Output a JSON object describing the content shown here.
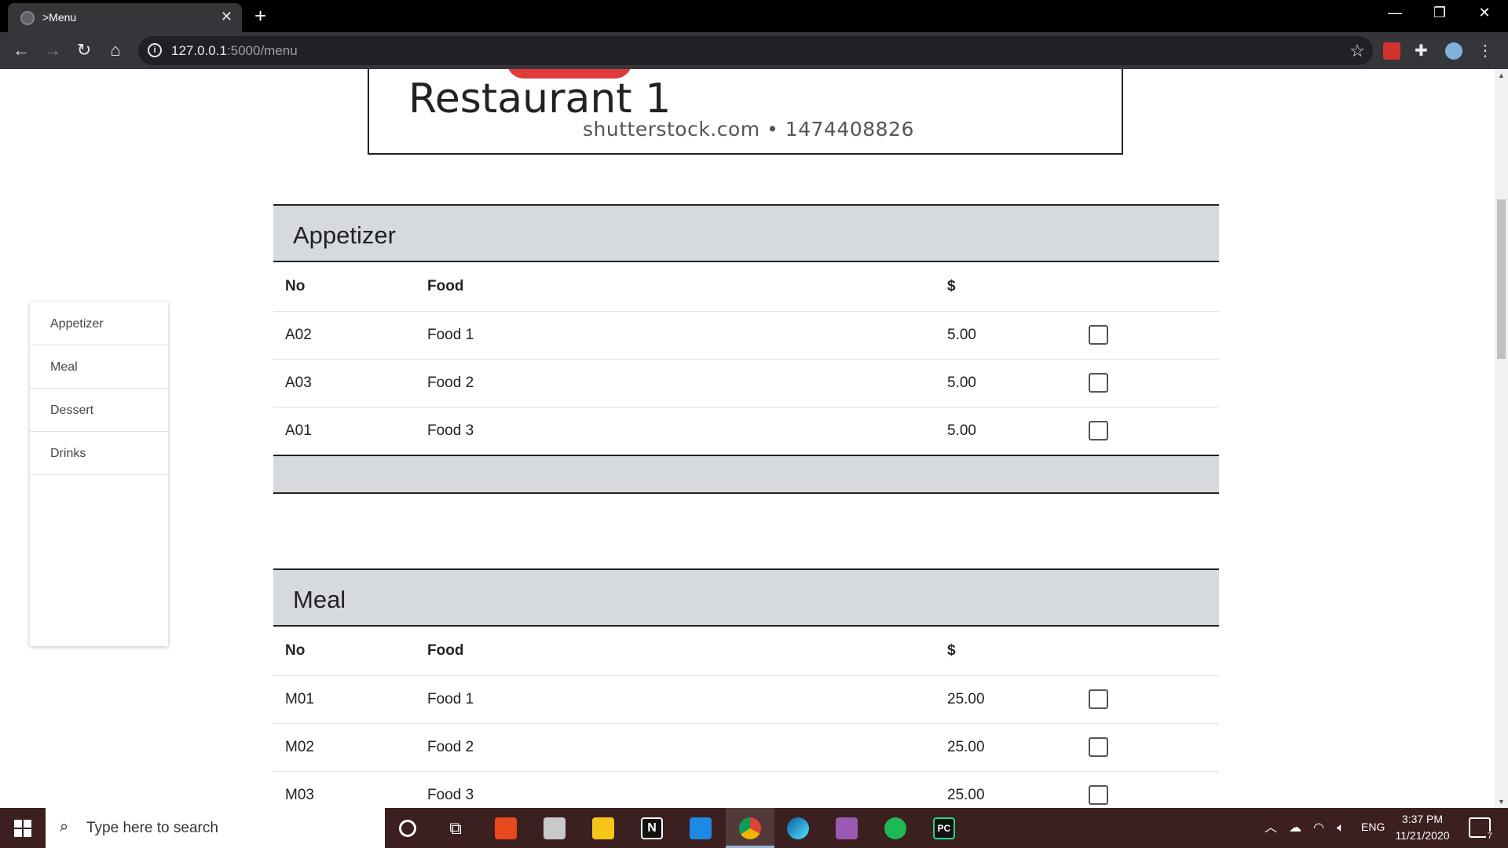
{
  "browser": {
    "tab_title": ">Menu",
    "url_host": "127.0.0.1",
    "url_rest": ":5000/menu"
  },
  "header": {
    "restaurant_name": "Restaurant 1",
    "watermark": "shutterstock.com • 1474408826"
  },
  "sidenav": {
    "items": [
      {
        "label": "Appetizer"
      },
      {
        "label": "Meal"
      },
      {
        "label": "Dessert"
      },
      {
        "label": "Drinks"
      }
    ]
  },
  "sections": [
    {
      "title": "Appetizer",
      "columns": [
        "No",
        "Food",
        "$"
      ],
      "rows": [
        {
          "no": "A02",
          "food": "Food 1",
          "price": "5.00",
          "checked": false
        },
        {
          "no": "A03",
          "food": "Food 2",
          "price": "5.00",
          "checked": false
        },
        {
          "no": "A01",
          "food": "Food 3",
          "price": "5.00",
          "checked": false
        }
      ]
    },
    {
      "title": "Meal",
      "columns": [
        "No",
        "Food",
        "$"
      ],
      "rows": [
        {
          "no": "M01",
          "food": "Food 1",
          "price": "25.00",
          "checked": false
        },
        {
          "no": "M02",
          "food": "Food 2",
          "price": "25.00",
          "checked": false
        },
        {
          "no": "M03",
          "food": "Food 3",
          "price": "25.00",
          "checked": false
        }
      ]
    }
  ],
  "taskbar": {
    "search_placeholder": "Type here to search",
    "language": "ENG",
    "time": "3:37 PM",
    "date": "11/21/2020",
    "notification_count": "7"
  },
  "colors": {
    "section_header_bg": "#d6dadf",
    "chrome_bg": "#35363a",
    "taskbar_bg": "#3c1f1f"
  }
}
